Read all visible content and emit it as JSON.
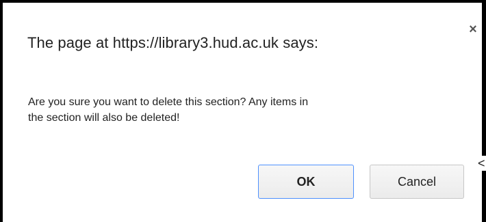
{
  "dialog": {
    "title": "The page at https://library3.hud.ac.uk says:",
    "close_glyph": "×",
    "message_line1": "Are you sure you want to delete this section? Any items in",
    "message_line2": "the section will also be deleted!",
    "ok_label": "OK",
    "cancel_label": "Cancel"
  },
  "annotation": {
    "arrow_glyph": "<"
  },
  "colors": {
    "frame": "#000000",
    "ok_border_focus": "#4d90fe",
    "button_border": "#c6c6c6"
  }
}
